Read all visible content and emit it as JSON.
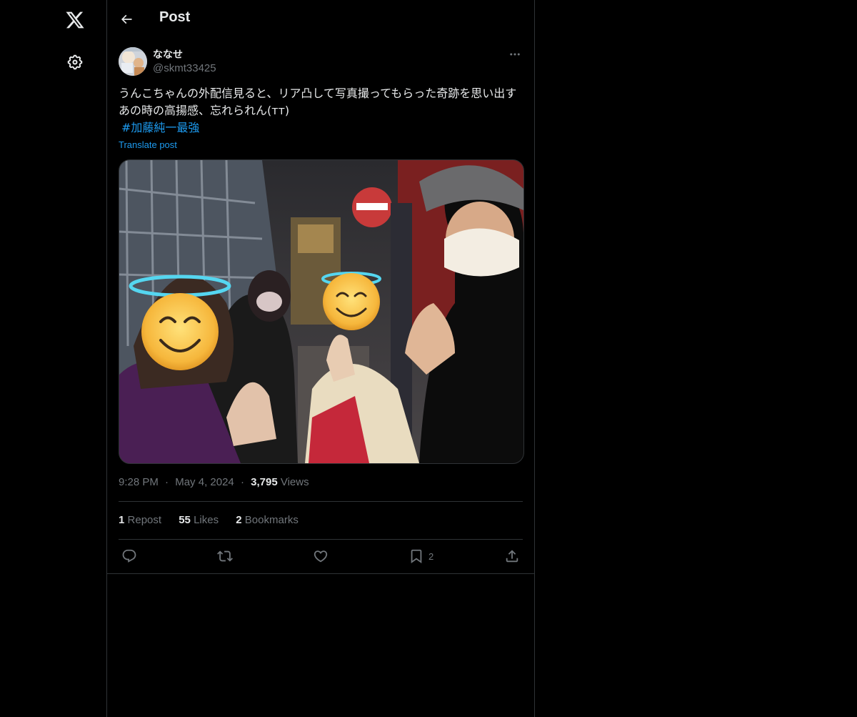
{
  "header": {
    "title": "Post"
  },
  "author": {
    "display_name": "ななせ",
    "handle": "@skmt33425"
  },
  "post": {
    "text_line": "うんこちゃんの外配信見ると、リア凸して写真撮ってもらった奇跡を思い出す あの時の高揚感、忘れられん(ᴛᴛ)",
    "hashtag": "#加藤純一最強",
    "translate_label": "Translate post"
  },
  "meta": {
    "time": "9:28 PM",
    "date": "May 4, 2024",
    "views_count": "3,795",
    "views_label": "Views",
    "separator": "·"
  },
  "stats": {
    "reposts_count": "1",
    "reposts_label": "Repost",
    "likes_count": "55",
    "likes_label": "Likes",
    "bookmarks_count": "2",
    "bookmarks_label": "Bookmarks"
  },
  "actions": {
    "bookmark_count": "2"
  },
  "icons": {
    "rail": [
      "x-logo-icon",
      "settings-gear-icon"
    ],
    "header": [
      "back-arrow-icon"
    ],
    "post": [
      "more-options-icon",
      "reply-icon",
      "repost-icon",
      "like-heart-icon",
      "bookmark-icon",
      "share-icon"
    ]
  },
  "colors": {
    "background": "#000000",
    "text": "#e7e9ea",
    "muted": "#71767b",
    "accent": "#1d9bf0",
    "border": "#2f3336"
  }
}
